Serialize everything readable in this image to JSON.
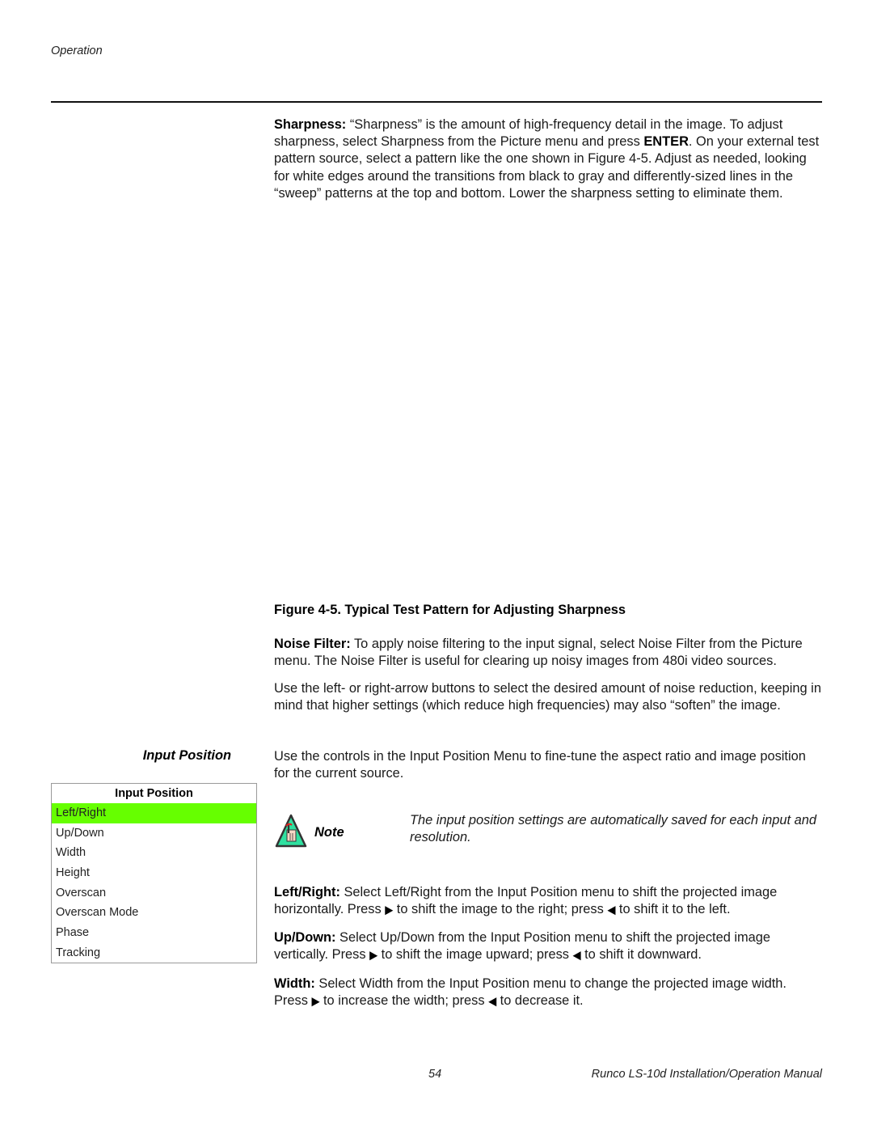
{
  "header": {
    "section": "Operation"
  },
  "sharpness": {
    "term": "Sharpness:",
    "text_1": " “Sharpness” is the amount of high-frequency detail in the image. To adjust sharpness, select Sharpness from the Picture menu and press ",
    "key": "ENTER",
    "text_2": ". On your external test pattern source, select a pattern like the one shown in Figure 4-5. Adjust as needed, looking for white edges around the transitions from black to gray and differently-sized lines in the “sweep” patterns at the top and bottom. Lower the sharpness setting to eliminate them."
  },
  "figure": {
    "caption": "Figure 4-5. Typical Test Pattern for Adjusting Sharpness"
  },
  "noise_filter": {
    "term": "Noise Filter:",
    "text": " To apply noise filtering to the input signal, select Noise Filter from the Picture menu. The Noise Filter is useful for clearing up noisy images from 480i video sources.",
    "paragraph_2": "Use the left- or right-arrow buttons to select the desired amount of noise reduction, keeping in mind that higher settings (which reduce high frequencies) may also “soften” the image."
  },
  "input_position": {
    "side_heading": "Input Position",
    "intro": "Use the controls in the Input Position Menu to fine-tune the aspect ratio and image position for the current source.",
    "menu": {
      "title": "Input Position",
      "items": [
        {
          "label": "Left/Right",
          "selected": true
        },
        {
          "label": "Up/Down",
          "selected": false
        },
        {
          "label": "Width",
          "selected": false
        },
        {
          "label": "Height",
          "selected": false
        },
        {
          "label": "Overscan",
          "selected": false
        },
        {
          "label": "Overscan Mode",
          "selected": false
        },
        {
          "label": "Phase",
          "selected": false
        },
        {
          "label": "Tracking",
          "selected": false
        }
      ],
      "highlight_color": "#66ff00"
    },
    "note": {
      "icon": "note-hand-icon",
      "label": "Note",
      "text": "The input position settings are automatically saved for each input and resolution."
    },
    "left_right": {
      "term": "Left/Right:",
      "text_1": " Select Left/Right from the Input Position menu to shift the projected image horizontally. Press ",
      "text_2": " to shift the image to the right; press ",
      "text_3": " to shift it to the left."
    },
    "up_down": {
      "term": "Up/Down:",
      "text_1": " Select Up/Down from the Input Position menu to shift the projected image vertically. Press ",
      "text_2": " to shift the image upward; press ",
      "text_3": " to shift it downward."
    },
    "width": {
      "term": "Width:",
      "text_1": " Select Width from the Input Position menu to change the projected image width. Press ",
      "text_2": " to increase the width; press ",
      "text_3": " to decrease it."
    },
    "arrow_right": "▶",
    "arrow_left": "◀"
  },
  "footer": {
    "page_number": "54",
    "manual_title": "Runco LS-10d Installation/Operation Manual"
  }
}
